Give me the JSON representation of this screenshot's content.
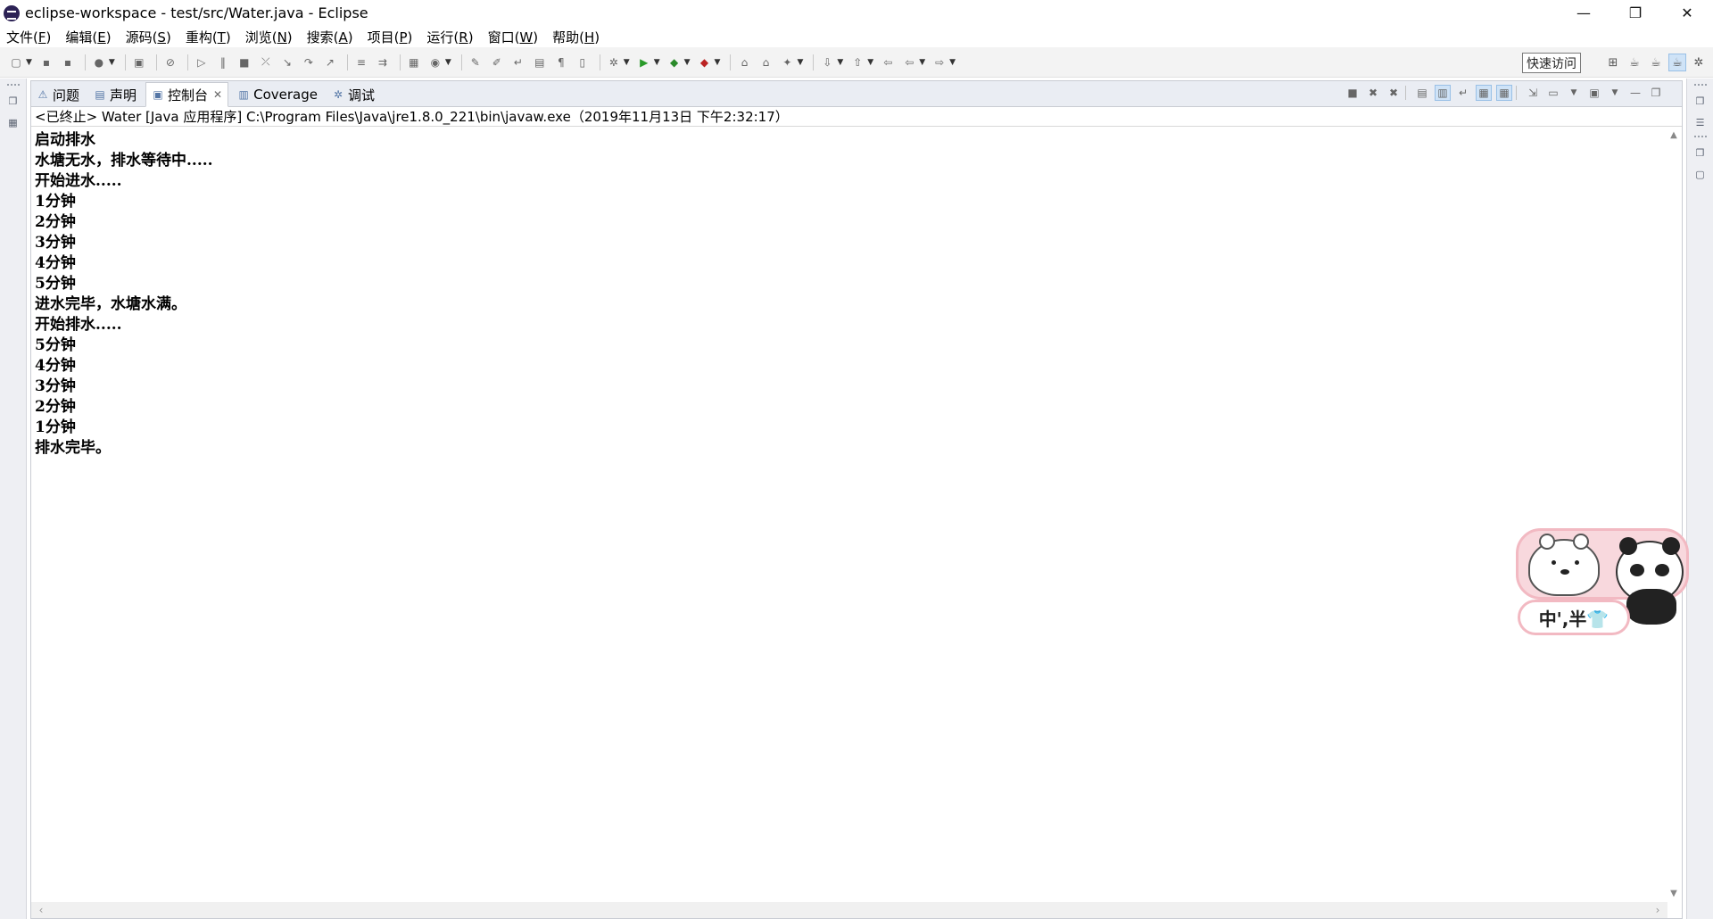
{
  "window": {
    "title": "eclipse-workspace - test/src/Water.java - Eclipse",
    "minimize": "—",
    "restore": "❐",
    "close": "✕"
  },
  "menu": [
    {
      "label": "文件(",
      "key": "F",
      "end": ")"
    },
    {
      "label": "编辑(",
      "key": "E",
      "end": ")"
    },
    {
      "label": "源码(",
      "key": "S",
      "end": ")"
    },
    {
      "label": "重构(",
      "key": "T",
      "end": ")"
    },
    {
      "label": "浏览(",
      "key": "N",
      "end": ")"
    },
    {
      "label": "搜索(",
      "key": "A",
      "end": ")"
    },
    {
      "label": "项目(",
      "key": "P",
      "end": ")"
    },
    {
      "label": "运行(",
      "key": "R",
      "end": ")"
    },
    {
      "label": "窗口(",
      "key": "W",
      "end": ")"
    },
    {
      "label": "帮助(",
      "key": "H",
      "end": ")"
    }
  ],
  "toolbar": {
    "quick_access": "快速访问"
  },
  "tabs": [
    {
      "label": "问题",
      "icon": "problems-icon",
      "glyph": "⚠"
    },
    {
      "label": "声明",
      "icon": "declaration-icon",
      "glyph": "▤"
    },
    {
      "label": "控制台",
      "icon": "console-icon",
      "glyph": "▣",
      "close": "✕"
    },
    {
      "label": "Coverage",
      "icon": "coverage-icon",
      "glyph": "▥"
    },
    {
      "label": "调试",
      "icon": "debug-icon",
      "glyph": "✲"
    }
  ],
  "console": {
    "header": "<已终止> Water [Java 应用程序] C:\\Program Files\\Java\\jre1.8.0_221\\bin\\javaw.exe（2019年11月13日 下午2:32:17）",
    "lines": [
      "启动排水",
      "水塘无水，排水等待中.....",
      "开始进水.....",
      "1分钟",
      "2分钟",
      "3分钟",
      "4分钟",
      "5分钟",
      "进水完毕，水塘水满。",
      "开始排水.....",
      "5分钟",
      "4分钟",
      "3分钟",
      "2分钟",
      "1分钟",
      "排水完毕。"
    ]
  },
  "sticker": {
    "label": "中',半👕"
  },
  "colors": {
    "toolbar_bg": "#f3f3f3",
    "tabbar_bg": "#eaedf3",
    "sticker_pink": "#f8d8dd"
  }
}
